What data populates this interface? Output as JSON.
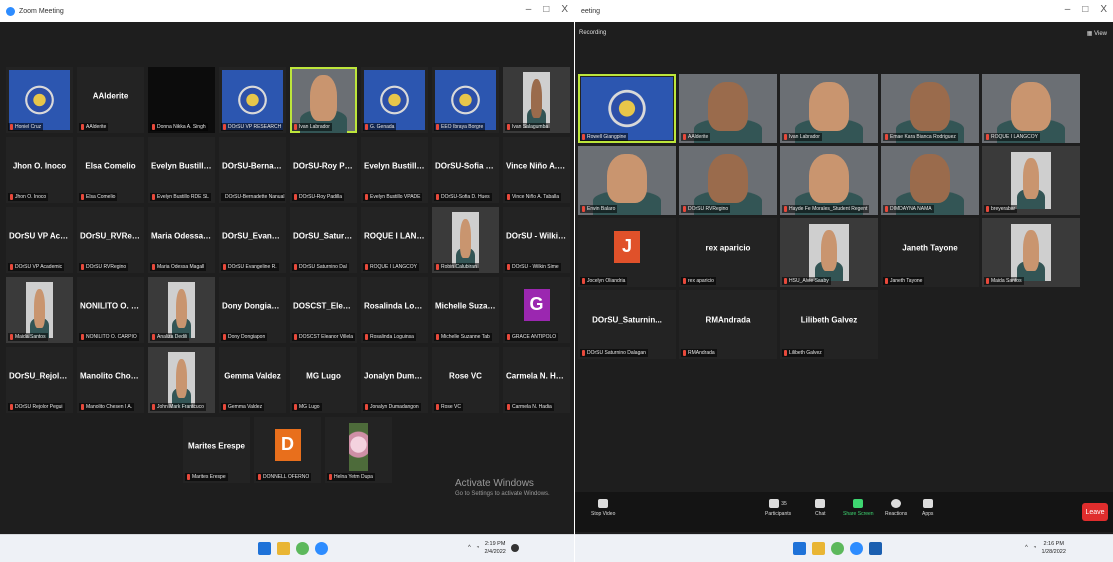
{
  "left_window": {
    "title": "Zoom Meeting",
    "controls": [
      "–",
      "□",
      "X"
    ],
    "watermark": {
      "title": "Activate Windows",
      "subtitle": "Go to Settings to activate Windows."
    },
    "tiles": [
      [
        {
          "big": "",
          "label": "Honiel Cruz",
          "kind": "seal"
        },
        {
          "big": "AAlderite",
          "label": "AAlderite",
          "kind": "name"
        },
        {
          "big": "",
          "label": "Donna Nikka A. Singh",
          "kind": "dark"
        },
        {
          "big": "",
          "label": "DOrSU VP RESEARCH",
          "kind": "seal"
        },
        {
          "big": "",
          "label": "Ivan Labrador",
          "kind": "face",
          "active": true
        },
        {
          "big": "",
          "label": "G. Genada",
          "kind": "seal"
        },
        {
          "big": "",
          "label": "EEO Ibraya Borgre",
          "kind": "seal"
        },
        {
          "big": "",
          "label": "Ivan Salagumba",
          "kind": "photo"
        }
      ],
      [
        {
          "big": "Jhon O. Inoco",
          "label": "Jhon O. Inoco",
          "kind": "name"
        },
        {
          "big": "Elsa Comelio",
          "label": "Elsa Comelio",
          "kind": "name"
        },
        {
          "big": "Evelyn Bustillo_...",
          "label": "Evelyn Bustillo RDE SL",
          "kind": "name"
        },
        {
          "big": "DOrSU-Bernade...",
          "label": "DOrSU-Bernadette Nanual",
          "kind": "name"
        },
        {
          "big": "DOrSU-Roy Padi...",
          "label": "DOrSU-Roy Padilla",
          "kind": "name"
        },
        {
          "big": "Evelyn Bustillo_...",
          "label": "Evelyn Bustillo VPADE",
          "kind": "name"
        },
        {
          "big": "DOrSU-Sofia D...",
          "label": "DOrSU-Sofia D. Hues",
          "kind": "name"
        },
        {
          "big": "Vince Niño A. T...",
          "label": "Vince Niño A. Taballa",
          "kind": "name"
        }
      ],
      [
        {
          "big": "DOrSU VP Acad...",
          "label": "DOrSU VP Academic",
          "kind": "name"
        },
        {
          "big": "DOrSU_RVRegino",
          "label": "DOrSU RVRegino",
          "kind": "name"
        },
        {
          "big": "Maria Odessa M...",
          "label": "Maria Odessa Magall",
          "kind": "name"
        },
        {
          "big": "DOrSU_Evangeli...",
          "label": "DOrSU Evangeline R.",
          "kind": "name"
        },
        {
          "big": "DOrSU_Saturnin...",
          "label": "DOrSU Saturnino Dal",
          "kind": "name"
        },
        {
          "big": "ROQUE I LANG...",
          "label": "ROQUE I LANGCOY",
          "kind": "name"
        },
        {
          "big": "",
          "label": "Robin Calubiran",
          "kind": "photo"
        },
        {
          "big": "DOrSU - Wilkin...",
          "label": "DOrSU - Wilkin Sime",
          "kind": "name"
        }
      ],
      [
        {
          "big": "",
          "label": "Maida Santos",
          "kind": "photo"
        },
        {
          "big": "NONILITO O. CA...",
          "label": "NONILITO O. CARPIO",
          "kind": "name"
        },
        {
          "big": "",
          "label": "Analiza Dedili",
          "kind": "photo"
        },
        {
          "big": "Dony Dongiapon",
          "label": "Dony Dongiapon",
          "kind": "name"
        },
        {
          "big": "DOSCST_Eleano...",
          "label": "DOSCST Eleanor Villela",
          "kind": "name"
        },
        {
          "big": "Rosalinda Logui...",
          "label": "Rosalinda Loguinsa",
          "kind": "name"
        },
        {
          "big": "Michelle Suzann...",
          "label": "Michelle Suzanne Tab",
          "kind": "name"
        },
        {
          "big": "G",
          "label": "GRACE ANTIPOLO",
          "kind": "letter",
          "color": "#9b27b0"
        }
      ],
      [
        {
          "big": "DOrSU_Rejolor ...",
          "label": "DOrSU Rejolor Pegui",
          "kind": "name"
        },
        {
          "big": "Manolito Chose...",
          "label": "Manolito Chesen I A.",
          "kind": "name"
        },
        {
          "big": "",
          "label": "John Mark Frantcuco",
          "kind": "photo"
        },
        {
          "big": "Gemma Valdez",
          "label": "Gemma Valdez",
          "kind": "name"
        },
        {
          "big": "MG Lugo",
          "label": "MG Lugo",
          "kind": "name"
        },
        {
          "big": "Jonalyn Dumad...",
          "label": "Jonalyn Dumadangon",
          "kind": "name"
        },
        {
          "big": "Rose VC",
          "label": "Rose VC",
          "kind": "name"
        },
        {
          "big": "Carmela N. Hadia",
          "label": "Carmela N. Hadia",
          "kind": "name"
        }
      ],
      [
        {
          "big": "Marites Erespe",
          "label": "Marites Erespe",
          "kind": "name"
        },
        {
          "big": "D",
          "label": "DONNELL OFERNO",
          "kind": "letter",
          "color": "#e86f1c"
        },
        {
          "big": "",
          "label": "Helna Yetm Dupa",
          "kind": "flower"
        }
      ]
    ],
    "taskbar": {
      "time": "2:19 PM",
      "date": "2/4/2022"
    }
  },
  "right_window": {
    "title": "eeting",
    "subtitle": "Recording",
    "view_label": "View",
    "controls": [
      "–",
      "□",
      "X"
    ],
    "tiles": [
      [
        {
          "big": "",
          "label": "Rowell Giangpine",
          "kind": "seal",
          "active": true
        },
        {
          "big": "",
          "label": "AAlderite",
          "kind": "face"
        },
        {
          "big": "",
          "label": "Ivan Labrador",
          "kind": "face"
        },
        {
          "big": "",
          "label": "Emae Kara Bianca Rodriguez",
          "kind": "face"
        },
        {
          "big": "",
          "label": "ROQUE I LANGCOY",
          "kind": "face"
        }
      ],
      [
        {
          "big": "",
          "label": "Erwin Balaro",
          "kind": "face"
        },
        {
          "big": "",
          "label": "DOrSU RVRegino",
          "kind": "face"
        },
        {
          "big": "",
          "label": "Hayde Fe Morales_Student Regent",
          "kind": "face"
        },
        {
          "big": "",
          "label": "DIMDAYNA NAMA",
          "kind": "face"
        },
        {
          "big": "",
          "label": "breyerabar",
          "kind": "photo"
        }
      ],
      [
        {
          "big": "J",
          "label": "Jocelyn Oliandria",
          "kind": "letter",
          "color": "#e0512a"
        },
        {
          "big": "rex aparicio",
          "label": "rex aparicio",
          "kind": "name"
        },
        {
          "big": "",
          "label": "HSU_Alvie Saaby",
          "kind": "photo"
        },
        {
          "big": "Janeth Tayone",
          "label": "Janeth Tayone",
          "kind": "name"
        },
        {
          "big": "",
          "label": "Maida Santos",
          "kind": "photo"
        }
      ],
      [
        {
          "big": "DOrSU_Saturnin...",
          "label": "DOrSU Saturnino Dalagan",
          "kind": "name"
        },
        {
          "big": "RMAndrada",
          "label": "RMAndrada",
          "kind": "name"
        },
        {
          "big": "Lilibeth Galvez",
          "label": "Lilibeth Galvez",
          "kind": "name"
        }
      ]
    ],
    "toolbar": {
      "stop_video": "Stop Video",
      "participants": "Participants",
      "participants_count": "35",
      "chat": "Chat",
      "share": "Share Screen",
      "reactions": "Reactions",
      "apps": "Apps",
      "leave": "Leave"
    },
    "taskbar": {
      "time": "2:16 PM",
      "date": "1/28/2022"
    }
  },
  "colors": {
    "accent_green": "#bde63b",
    "share_green": "#3ed671",
    "leave_red": "#e02d2d",
    "mute_red": "#e8493b"
  }
}
